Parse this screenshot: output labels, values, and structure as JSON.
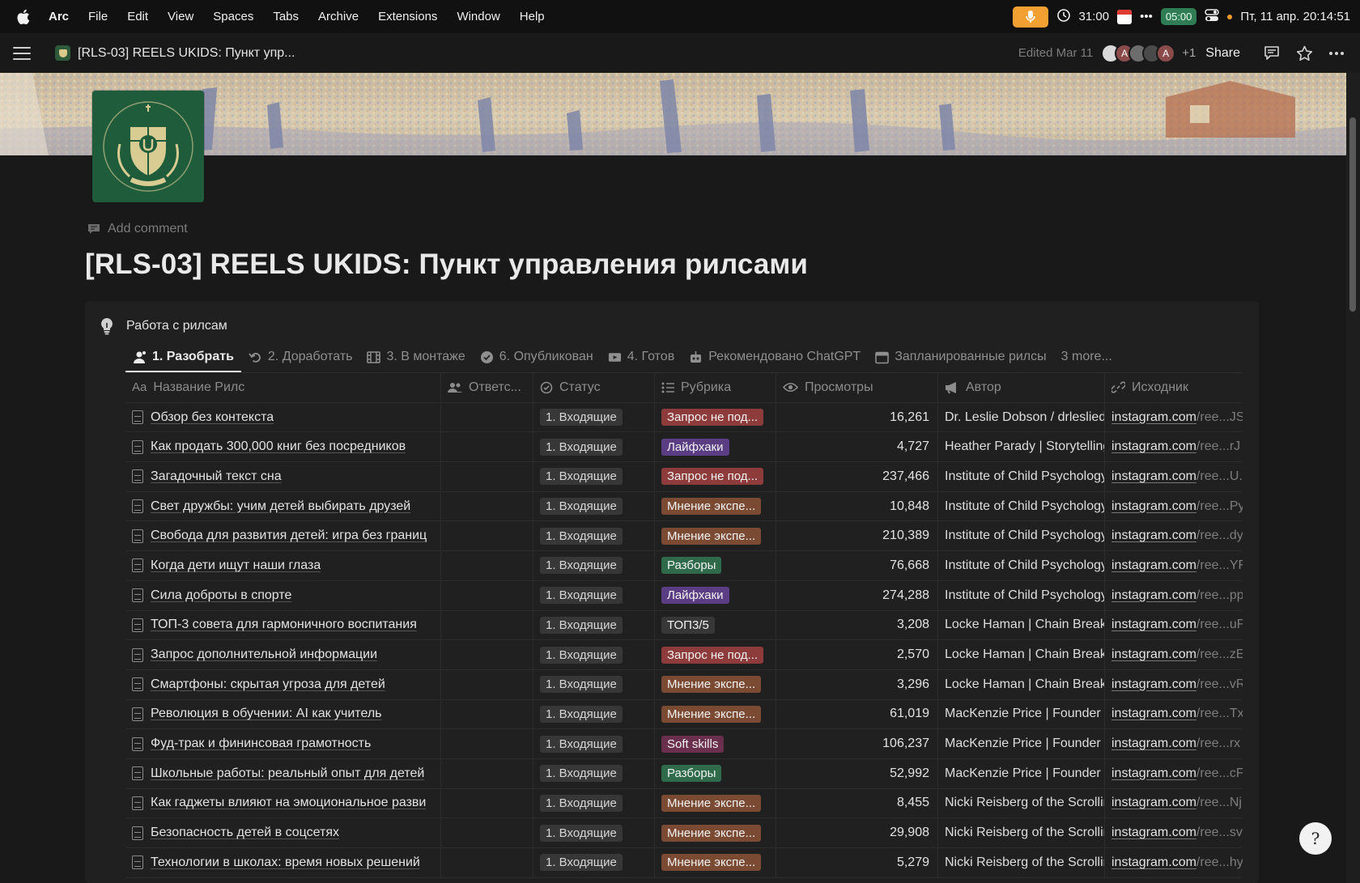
{
  "menubar": {
    "items": [
      "Arc",
      "File",
      "Edit",
      "View",
      "Spaces",
      "Tabs",
      "Archive",
      "Extensions",
      "Window",
      "Help"
    ],
    "timer": "31:00",
    "pill_time": "05:00",
    "datetime": "Пт, 11 апр.  20:14:51",
    "dots": "•••"
  },
  "topbar": {
    "breadcrumb": "[RLS-03] REELS UKIDS: Пункт упр...",
    "edited": "Edited Mar 11",
    "avatars": [
      "",
      "A",
      "",
      "",
      "A"
    ],
    "plus_count": "+1",
    "share": "Share"
  },
  "page": {
    "add_comment": "Add comment",
    "title": "[RLS-03] REELS UKIDS: Пункт управления рилсами"
  },
  "callout": {
    "title": "Работа с рилсам",
    "tabs": [
      {
        "label": "1. Разобрать",
        "icon": "person-icon"
      },
      {
        "label": "2. Доработать",
        "icon": "undo-icon"
      },
      {
        "label": "3. В монтаже",
        "icon": "film-icon"
      },
      {
        "label": "6. Опубликован",
        "icon": "check-circle-icon"
      },
      {
        "label": "4. Готов",
        "icon": "video-icon"
      },
      {
        "label": "Рекомендовано ChatGPT",
        "icon": "robot-icon"
      },
      {
        "label": "Запланированные рилсы",
        "icon": "calendar-icon"
      }
    ],
    "more": "3 more..."
  },
  "table": {
    "headers": {
      "name": "Название Рилс",
      "name_icon_text": "Aa",
      "responsible": "Ответс...",
      "status": "Статус",
      "rubric": "Рубрика",
      "views": "Просмотры",
      "author": "Автор",
      "source": "Исходник"
    },
    "rubric_colors": {
      "Запрос не под...": "#8e3b3b",
      "Лайфхаки": "#5b3d83",
      "Мнение экспе...": "#7b4a33",
      "Разборы": "#2f6b4a",
      "ТОП3/5": "#373737",
      "Soft skills": "#6b2f4e"
    },
    "rows": [
      {
        "title": "Обзор без контекста",
        "status": "1. Входящие",
        "rubric": "Запрос не под...",
        "views": "16,261",
        "author": "Dr. Leslie Dobson / drleslied",
        "src_main": "instagram.com",
        "src_dim": "/ree...JS"
      },
      {
        "title": "Как продать 300,000 книг без посредников",
        "status": "1. Входящие",
        "rubric": "Лайфхаки",
        "views": "4,727",
        "author": "Heather Parady | Storytelling",
        "src_main": "instagram.com",
        "src_dim": "/ree...rJ"
      },
      {
        "title": "Загадочный текст сна",
        "status": "1. Входящие",
        "rubric": "Запрос не под...",
        "views": "237,466",
        "author": "Institute of Child Psychology",
        "src_main": "instagram.com",
        "src_dim": "/ree...U."
      },
      {
        "title": "Свет дружбы: учим детей выбирать друзей",
        "status": "1. Входящие",
        "rubric": "Мнение экспе...",
        "views": "10,848",
        "author": "Institute of Child Psychology",
        "src_main": "instagram.com",
        "src_dim": "/ree...Py"
      },
      {
        "title": "Свобода для развития детей: игра без границ",
        "status": "1. Входящие",
        "rubric": "Мнение экспе...",
        "views": "210,389",
        "author": "Institute of Child Psychology",
        "src_main": "instagram.com",
        "src_dim": "/ree...dy"
      },
      {
        "title": "Когда дети ищут наши глаза",
        "status": "1. Входящие",
        "rubric": "Разборы",
        "views": "76,668",
        "author": "Institute of Child Psychology",
        "src_main": "instagram.com",
        "src_dim": "/ree...YF"
      },
      {
        "title": "Сила доброты в спорте",
        "status": "1. Входящие",
        "rubric": "Лайфхаки",
        "views": "274,288",
        "author": "Institute of Child Psychology",
        "src_main": "instagram.com",
        "src_dim": "/ree...pp"
      },
      {
        "title": "ТОП-3 совета для гармоничного воспитания",
        "status": "1. Входящие",
        "rubric": "ТОП3/5",
        "views": "3,208",
        "author": "Locke Haman | Chain Breaker",
        "src_main": "instagram.com",
        "src_dim": "/ree...uF"
      },
      {
        "title": "Запрос дополнительной информации",
        "status": "1. Входящие",
        "rubric": "Запрос не под...",
        "views": "2,570",
        "author": "Locke Haman | Chain Breaker",
        "src_main": "instagram.com",
        "src_dim": "/ree...zE"
      },
      {
        "title": "Смартфоны: скрытая угроза для детей",
        "status": "1. Входящие",
        "rubric": "Мнение экспе...",
        "views": "3,296",
        "author": "Locke Haman | Chain Breaker",
        "src_main": "instagram.com",
        "src_dim": "/ree...vR"
      },
      {
        "title": "Революция в обучении: AI как учитель",
        "status": "1. Входящие",
        "rubric": "Мнение экспе...",
        "views": "61,019",
        "author": "MacKenzie Price | Founder of",
        "src_main": "instagram.com",
        "src_dim": "/ree...Tx"
      },
      {
        "title": "Фуд-трак и фининсовая грамотность",
        "status": "1. Входящие",
        "rubric": "Soft skills",
        "views": "106,237",
        "author": "MacKenzie Price | Founder of",
        "src_main": "instagram.com",
        "src_dim": "/ree...rx"
      },
      {
        "title": "Школьные работы: реальный опыт для детей",
        "status": "1. Входящие",
        "rubric": "Разборы",
        "views": "52,992",
        "author": "MacKenzie Price | Founder of",
        "src_main": "instagram.com",
        "src_dim": "/ree...cF"
      },
      {
        "title": "Как гаджеты влияют на эмоциональное разви",
        "status": "1. Входящие",
        "rubric": "Мнение экспе...",
        "views": "8,455",
        "author": "Nicki Reisberg of the Scrolling",
        "src_main": "instagram.com",
        "src_dim": "/ree...Nj"
      },
      {
        "title": "Безопасность детей в соцсетях",
        "status": "1. Входящие",
        "rubric": "Мнение экспе...",
        "views": "29,908",
        "author": "Nicki Reisberg of the Scrolling",
        "src_main": "instagram.com",
        "src_dim": "/ree...sv"
      },
      {
        "title": "Технологии в школах: время новых решений",
        "status": "1. Входящие",
        "rubric": "Мнение экспе...",
        "views": "5,279",
        "author": "Nicki Reisberg of the Scrolling",
        "src_main": "instagram.com",
        "src_dim": "/ree...hy"
      }
    ]
  },
  "help": {
    "glyph": "?"
  }
}
